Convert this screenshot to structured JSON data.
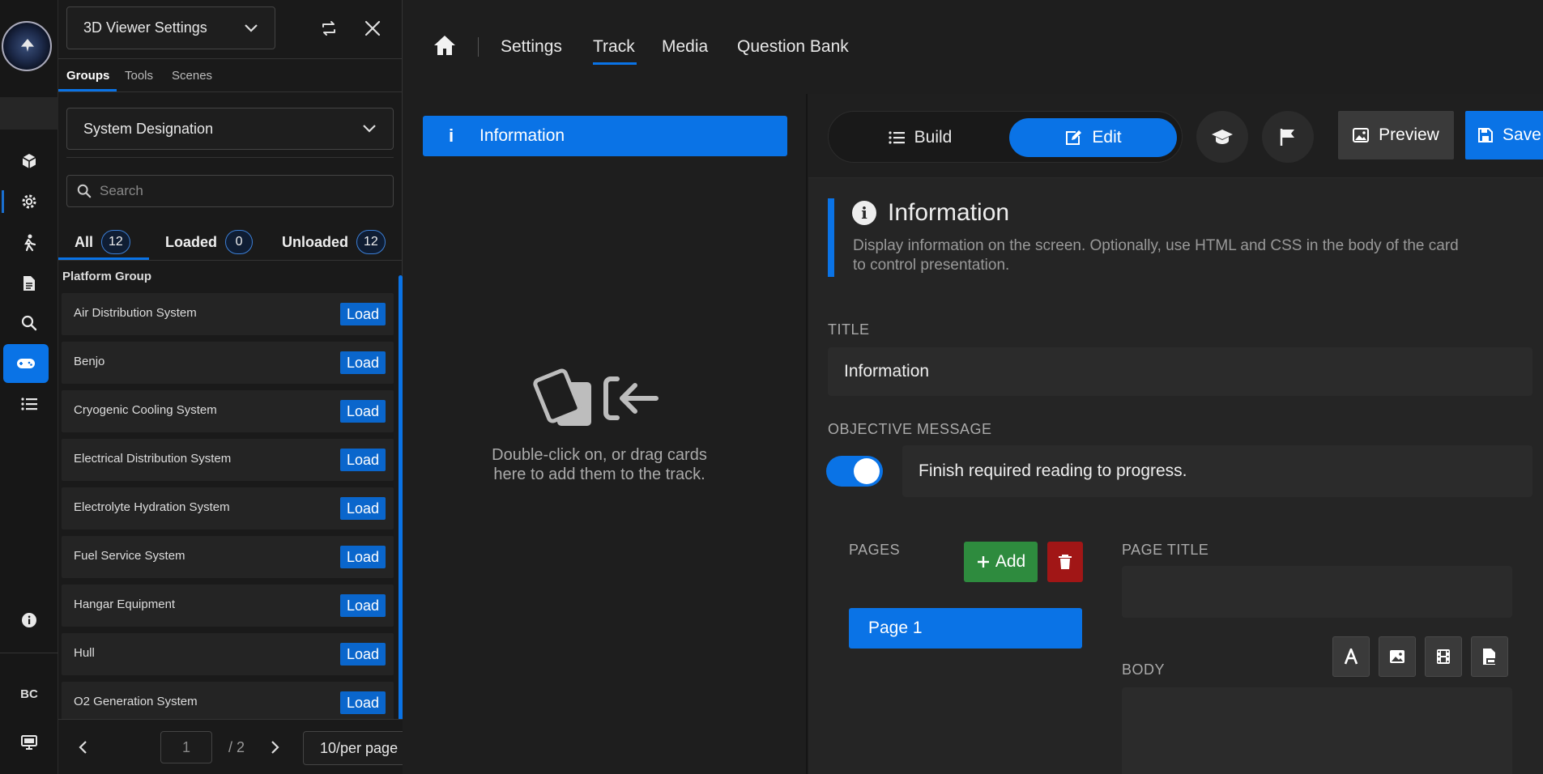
{
  "colors": {
    "accent": "#0a73e6",
    "add": "#2e8b3e",
    "delete": "#a11616",
    "bg": "#1e1e1e"
  },
  "rail": {
    "avatar": "BC",
    "icons": [
      "cube-icon",
      "gear-icon",
      "walking-person-icon",
      "document-icon",
      "search-icon",
      "gamepad-icon",
      "list-icon",
      "info-icon",
      "monitor-icon"
    ],
    "active": "gamepad-icon"
  },
  "panel": {
    "viewer_title": "3D Viewer Settings",
    "tabs": [
      "Groups",
      "Tools",
      "Scenes"
    ],
    "active_tab": "Groups",
    "designation": "System Designation",
    "search_placeholder": "Search",
    "filters": [
      {
        "label": "All",
        "count": "12"
      },
      {
        "label": "Loaded",
        "count": "0"
      },
      {
        "label": "Unloaded",
        "count": "12"
      }
    ],
    "group_label": "Platform Group",
    "items": [
      {
        "name": "Air Distribution System",
        "action": "Load"
      },
      {
        "name": "Benjo",
        "action": "Load"
      },
      {
        "name": "Cryogenic Cooling System",
        "action": "Load"
      },
      {
        "name": "Electrical Distribution System",
        "action": "Load"
      },
      {
        "name": "Electrolyte Hydration System",
        "action": "Load"
      },
      {
        "name": "Fuel Service System",
        "action": "Load"
      },
      {
        "name": "Hangar Equipment",
        "action": "Load"
      },
      {
        "name": "Hull",
        "action": "Load"
      },
      {
        "name": "O2 Generation System",
        "action": "Load"
      }
    ],
    "pager": {
      "page": "1",
      "total": "/ 2",
      "per_page": "10/per page"
    }
  },
  "nav": {
    "tabs": [
      "Settings",
      "Track",
      "Media",
      "Question Bank"
    ],
    "active": "Track"
  },
  "track": {
    "card_label": "Information",
    "card_icon": "i",
    "drop_hint": "Double-click on, or drag cards here to add them to the track."
  },
  "toolbar": {
    "build": "Build",
    "edit": "Edit",
    "preview": "Preview",
    "save": "Save"
  },
  "card": {
    "title": "Information",
    "icon": "i",
    "description": "Display information on the screen. Optionally, use HTML and CSS in the body of the card to control presentation.",
    "title_label": "TITLE",
    "title_value": "Information",
    "objective_label": "OBJECTIVE MESSAGE",
    "objective_value": "Finish required reading to progress.",
    "objective_enabled": true,
    "pages_label": "PAGES",
    "add_label": "Add",
    "page_item": "Page 1",
    "page_title_label": "PAGE TITLE",
    "page_title_value": "",
    "body_label": "BODY"
  }
}
